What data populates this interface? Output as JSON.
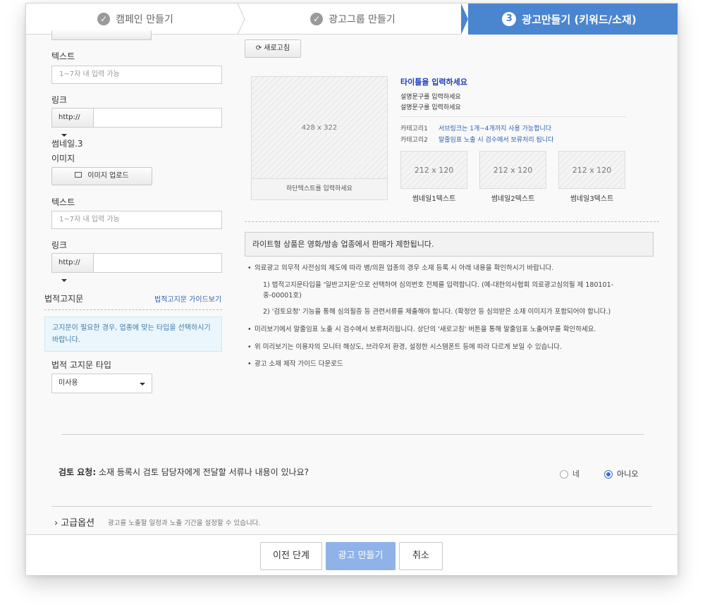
{
  "steps": [
    {
      "label": "캠페인 만들기"
    },
    {
      "label": "광고그룹 만들기"
    },
    {
      "label": "광고만들기 (키워드/소재)",
      "number": "3"
    }
  ],
  "left": {
    "text_label_1": "텍스트",
    "text_placeholder_1": "1~7자 내 입력 가능",
    "link_label_1": "링크",
    "protocol_1": "http://",
    "thumb3_label": "썸네일.3",
    "image_label": "이미지",
    "image_upload_btn": "이미지 업로드",
    "text_label_2": "텍스트",
    "text_placeholder_2": "1~7자 내 입력 가능",
    "link_label_2": "링크",
    "protocol_2": "http://",
    "legal_title": "법적고지문",
    "legal_guide_link": "법적고지문 가이드보기",
    "legal_info": "고지문이 필요한 경우, 업종에 맞는 타입을 선택하시기 바랍니다.",
    "legal_type_label": "법적 고지문 타입",
    "legal_type_value": "미사용"
  },
  "preview": {
    "refresh_btn": "새로고침",
    "big_size": "428 x 322",
    "big_caption": "하단텍스트를 입력하세요",
    "title": "타이틀을 입력하세요",
    "desc1": "설명문구를 입력하세요",
    "desc2": "설명문구를 입력하세요",
    "cat1_label": "카테고리1",
    "cat1_text": "서브링크는 1개~4개까지 사용 가능합니다",
    "cat2_label": "카테고리2",
    "cat2_text": "말줄임표 노출 시 검수에서 보류처리 됩니다",
    "thumbs": [
      {
        "size": "212 x 120",
        "caption": "썸네일1텍스트"
      },
      {
        "size": "212 x 120",
        "caption": "썸네일2텍스트"
      },
      {
        "size": "212 x 120",
        "caption": "썸네일3텍스트"
      }
    ]
  },
  "notice": {
    "box": "라이트형 상품은 영화/방송 업종에서 판매가 제한됩니다.",
    "b1": "의료광고 의무적 사전심의 제도에 따라 병/의원 업종의 경우 소재 등록 시 아래 내용을 확인하시기 바랍니다.",
    "s1a": "1) 법적고지문타입을 '일반고지문'으로 선택하여 심의번호 전체를 입력합니다. (예-대한의사협회 의료광고심의필 제 180101-",
    "s1b": "중-00001호)",
    "s2": "2) '검토요청' 기능을 통해 심의필증 등 관련서류를 제출해야 합니다. (확정안 등 심의받은 소재 이미지가 포함되어야 합니다.)",
    "b2": "미리보기에서 말줄임표 노출 시 검수에서 보류처리됩니다. 상단의 '새로고침' 버튼을 통해 말줄임표 노출여부를 확인하세요.",
    "b3": "위 미리보기는 이용자의 모니터 해상도, 브라우저 환경, 설정한 시스템폰트 등에 따라 다르게 보일 수 있습니다.",
    "b4": "광고 소재 제작 가이드 다운로드"
  },
  "review": {
    "label": "검토 요청:",
    "question": "소재 등록시 검토 담당자에게 전달할 서류나 내용이 있나요?",
    "yes": "네",
    "no": "아니오",
    "selected": "no"
  },
  "advanced": {
    "title": "고급옵션",
    "desc": "광고를 노출할 일정과 노출 기간을 설정할 수 있습니다."
  },
  "footer": {
    "prev": "이전 단계",
    "create": "광고 만들기",
    "cancel": "취소"
  },
  "colors": {
    "accent": "#4a85cf",
    "link": "#2f62b4",
    "primary_disabled": "#8fb3e8"
  }
}
